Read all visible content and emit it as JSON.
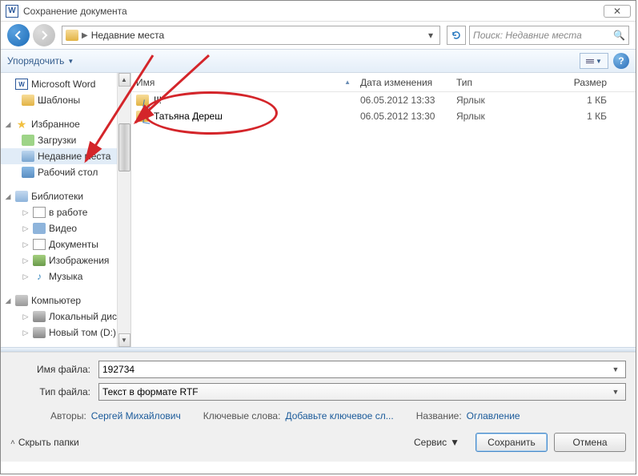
{
  "title": "Сохранение документа",
  "breadcrumb": {
    "location": "Недавние места"
  },
  "search": {
    "placeholder": "Поиск: Недавние места"
  },
  "toolbar": {
    "organize": "Упорядочить"
  },
  "tree": {
    "word": "Microsoft Word",
    "templates": "Шаблоны",
    "favorites": "Избранное",
    "downloads": "Загрузки",
    "recent": "Недавние места",
    "desktop": "Рабочий стол",
    "libraries": "Библиотеки",
    "inwork": "в работе",
    "video": "Видео",
    "documents": "Документы",
    "pictures": "Изображения",
    "music": "Музыка",
    "computer": "Компьютер",
    "localdisk": "Локальный диск (",
    "newvol": "Новый том (D:)"
  },
  "cols": {
    "name": "Имя",
    "date": "Дата изменения",
    "type": "Тип",
    "size": "Размер"
  },
  "files": [
    {
      "name": "!!!",
      "date": "06.05.2012 13:33",
      "type": "Ярлык",
      "size": "1 КБ"
    },
    {
      "name": "Татьяна Дереш",
      "date": "06.05.2012 13:30",
      "type": "Ярлык",
      "size": "1 КБ"
    }
  ],
  "form": {
    "filename_label": "Имя файла:",
    "filename_value": "192734",
    "type_label": "Тип файла:",
    "type_value": "Текст в формате RTF",
    "authors_label": "Авторы:",
    "authors_value": "Сергей Михайлович",
    "keywords_label": "Ключевые слова:",
    "keywords_value": "Добавьте ключевое сл...",
    "title_label": "Название:",
    "title_value": "Оглавление"
  },
  "buttons": {
    "hide": "Скрыть папки",
    "tools": "Сервис",
    "save": "Сохранить",
    "cancel": "Отмена"
  }
}
